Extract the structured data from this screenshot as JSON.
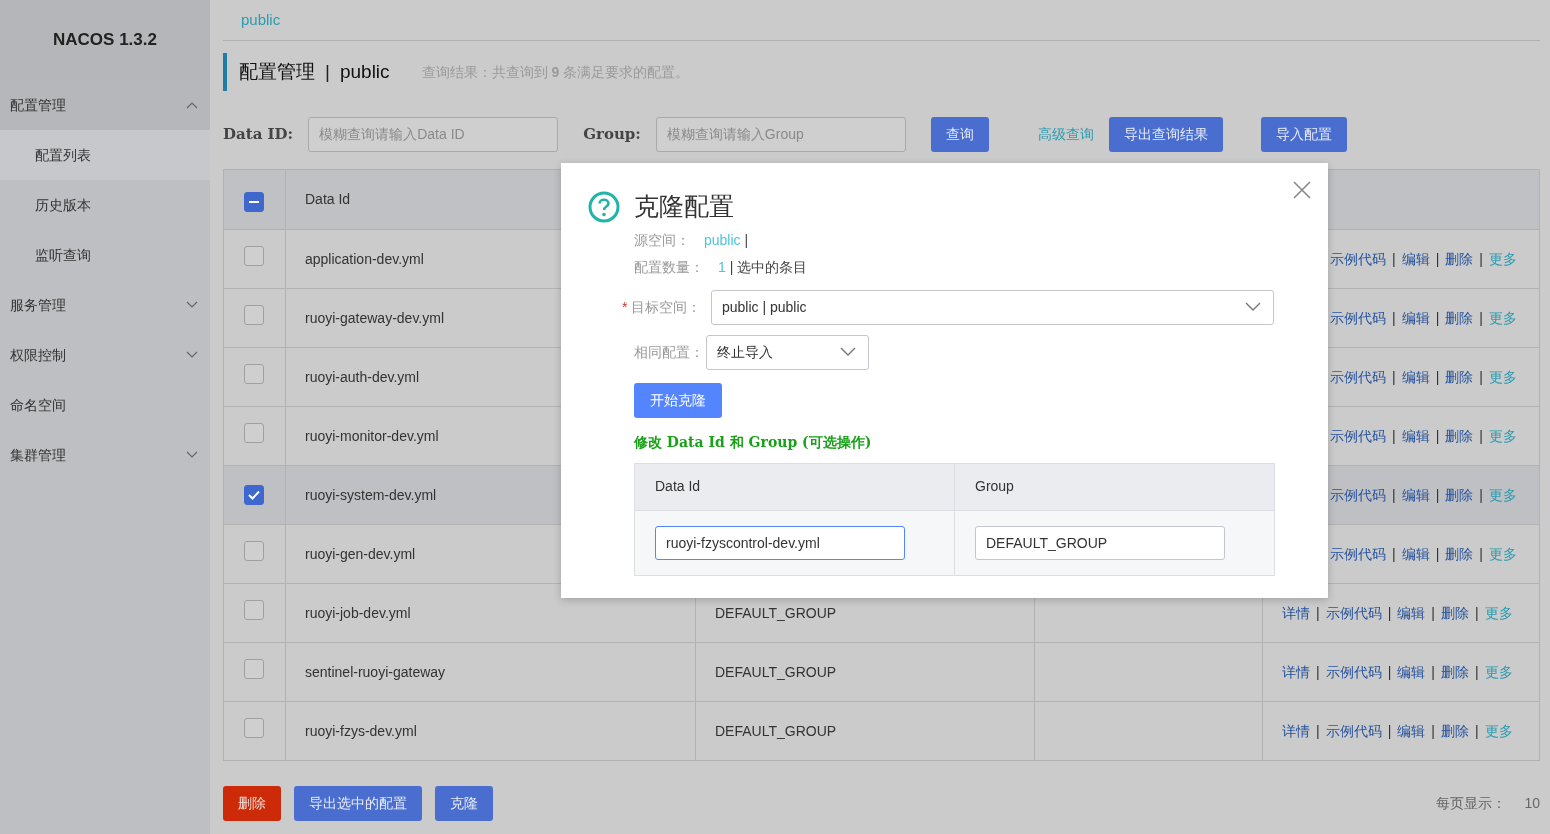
{
  "sidebar": {
    "title": "NACOS 1.3.2",
    "items": [
      {
        "label": "配置管理",
        "kind": "group",
        "expanded": true,
        "children": [
          {
            "label": "配置列表",
            "selected": true
          },
          {
            "label": "历史版本",
            "selected": false
          },
          {
            "label": "监听查询",
            "selected": false
          }
        ]
      },
      {
        "label": "服务管理",
        "kind": "group",
        "expanded": false
      },
      {
        "label": "权限控制",
        "kind": "group",
        "expanded": false
      },
      {
        "label": "命名空间",
        "kind": "link"
      },
      {
        "label": "集群管理",
        "kind": "group",
        "expanded": false
      }
    ]
  },
  "namespace_tabs": [
    {
      "label": "public",
      "selected": true
    }
  ],
  "page_header": {
    "title": "配置管理",
    "separator": "|",
    "namespace": "public",
    "summary": "查询结果：共查询到 **9** 条满足要求的配置。"
  },
  "search": {
    "fields": [
      {
        "label": "Data ID:",
        "placeholder": "模糊查询请输入Data ID"
      },
      {
        "label": "Group:",
        "placeholder": "模糊查询请输入Group"
      }
    ],
    "buttons": [
      {
        "label": "查询",
        "kind": "primary"
      },
      {
        "label": "高级查询",
        "kind": "link"
      },
      {
        "label": "导出查询结果",
        "kind": "primary"
      },
      {
        "label": "导入配置",
        "kind": "primary"
      }
    ]
  },
  "table": {
    "action_separator": "|",
    "header_checkbox": {
      "indeterminate": true
    },
    "columns": [
      "Data Id"
    ],
    "rows": [
      {
        "data_id": "application-dev.yml",
        "checked": false,
        "actions": [
          {
            "label": "示例代码",
            "kind": "link"
          },
          {
            "label": "编辑",
            "kind": "link"
          },
          {
            "label": "删除",
            "kind": "link"
          },
          {
            "label": "更多",
            "kind": "more"
          }
        ]
      },
      {
        "data_id": "ruoyi-gateway-dev.yml",
        "checked": false,
        "actions": [
          {
            "label": "示例代码",
            "kind": "link"
          },
          {
            "label": "编辑",
            "kind": "link"
          },
          {
            "label": "删除",
            "kind": "link"
          },
          {
            "label": "更多",
            "kind": "more"
          }
        ]
      },
      {
        "data_id": "ruoyi-auth-dev.yml",
        "checked": false,
        "actions": [
          {
            "label": "示例代码",
            "kind": "link"
          },
          {
            "label": "编辑",
            "kind": "link"
          },
          {
            "label": "删除",
            "kind": "link"
          },
          {
            "label": "更多",
            "kind": "more"
          }
        ]
      },
      {
        "data_id": "ruoyi-monitor-dev.yml",
        "checked": false,
        "actions": [
          {
            "label": "示例代码",
            "kind": "link"
          },
          {
            "label": "编辑",
            "kind": "link"
          },
          {
            "label": "删除",
            "kind": "link"
          },
          {
            "label": "更多",
            "kind": "more"
          }
        ]
      },
      {
        "data_id": "ruoyi-system-dev.yml",
        "checked": true,
        "actions": [
          {
            "label": "示例代码",
            "kind": "link"
          },
          {
            "label": "编辑",
            "kind": "link"
          },
          {
            "label": "删除",
            "kind": "link"
          },
          {
            "label": "更多",
            "kind": "more"
          }
        ]
      },
      {
        "data_id": "ruoyi-gen-dev.yml",
        "checked": false,
        "actions": [
          {
            "label": "示例代码",
            "kind": "link"
          },
          {
            "label": "编辑",
            "kind": "link"
          },
          {
            "label": "删除",
            "kind": "link"
          },
          {
            "label": "更多",
            "kind": "more"
          }
        ]
      },
      {
        "data_id": "ruoyi-job-dev.yml",
        "group": "DEFAULT_GROUP",
        "checked": false,
        "actions": [
          {
            "label": "详情",
            "kind": "link"
          },
          {
            "label": "示例代码",
            "kind": "link"
          },
          {
            "label": "编辑",
            "kind": "link"
          },
          {
            "label": "删除",
            "kind": "link"
          },
          {
            "label": "更多",
            "kind": "more"
          }
        ]
      },
      {
        "data_id": "sentinel-ruoyi-gateway",
        "group": "DEFAULT_GROUP",
        "checked": false,
        "actions": [
          {
            "label": "详情",
            "kind": "link"
          },
          {
            "label": "示例代码",
            "kind": "link"
          },
          {
            "label": "编辑",
            "kind": "link"
          },
          {
            "label": "删除",
            "kind": "link"
          },
          {
            "label": "更多",
            "kind": "more"
          }
        ]
      },
      {
        "data_id": "ruoyi-fzys-dev.yml",
        "group": "DEFAULT_GROUP",
        "checked": false,
        "actions": [
          {
            "label": "详情",
            "kind": "link"
          },
          {
            "label": "示例代码",
            "kind": "link"
          },
          {
            "label": "编辑",
            "kind": "link"
          },
          {
            "label": "删除",
            "kind": "link"
          },
          {
            "label": "更多",
            "kind": "more"
          }
        ]
      }
    ]
  },
  "footer": {
    "buttons": [
      {
        "label": "删除",
        "kind": "danger"
      },
      {
        "label": "导出选中的配置",
        "kind": "primary"
      },
      {
        "label": "克隆",
        "kind": "primary"
      }
    ],
    "page_size_label": "每页显示：",
    "page_size": "10"
  },
  "dialog": {
    "title": "克隆配置",
    "source_label": "源空间：",
    "source_value": "public",
    "source_suffix": "|",
    "count_label": "配置数量：",
    "count_value": "1",
    "count_suffix": "| 选中的条目",
    "target": {
      "label": "目标空间：",
      "required": true,
      "required_mark": "*",
      "value": "public | public"
    },
    "conflict": {
      "label": "相同配置：",
      "value": "终止导入"
    },
    "start_button": "开始克隆",
    "hint": "修改 Data Id 和 Group (可选操作)",
    "columns": [
      "Data Id",
      "Group"
    ],
    "row": {
      "data_id": "ruoyi-fzyscontrol-dev.yml",
      "group": "DEFAULT_GROUP"
    }
  }
}
